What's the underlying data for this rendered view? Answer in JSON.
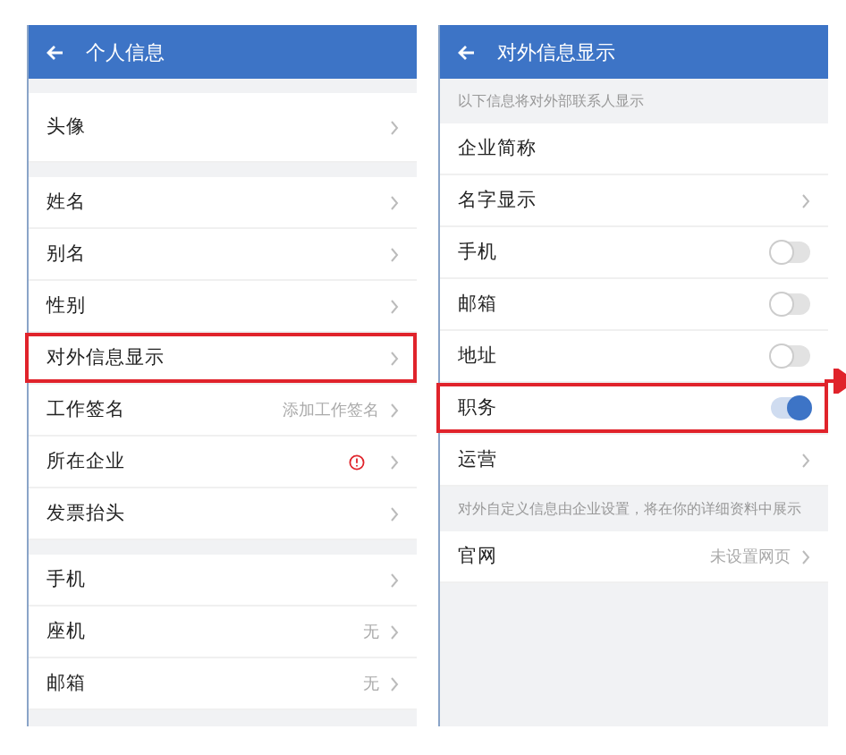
{
  "panels": [
    {
      "title": "个人信息",
      "groups": [
        {
          "rows": [
            {
              "kind": "link",
              "label": "头像",
              "tall": true,
              "highlighted": false
            }
          ]
        },
        {
          "rows": [
            {
              "kind": "link",
              "label": "姓名",
              "highlighted": false
            },
            {
              "kind": "link",
              "label": "别名",
              "highlighted": false
            },
            {
              "kind": "link",
              "label": "性别",
              "highlighted": false
            },
            {
              "kind": "link",
              "label": "对外信息显示",
              "highlighted": true
            },
            {
              "kind": "link",
              "label": "工作签名",
              "value": "添加工作签名",
              "highlighted": false
            },
            {
              "kind": "link",
              "label": "所在企业",
              "alert": true,
              "highlighted": false
            },
            {
              "kind": "link",
              "label": "发票抬头",
              "highlighted": false
            }
          ]
        },
        {
          "rows": [
            {
              "kind": "link",
              "label": "手机",
              "highlighted": false
            },
            {
              "kind": "link",
              "label": "座机",
              "value": "无",
              "highlighted": false
            },
            {
              "kind": "link",
              "label": "邮箱",
              "value": "无",
              "highlighted": false
            }
          ]
        }
      ]
    },
    {
      "title": "对外信息显示",
      "groups": [
        {
          "hint": "以下信息将对外部联系人显示",
          "rows": [
            {
              "kind": "plain",
              "label": "企业简称",
              "highlighted": false
            },
            {
              "kind": "link",
              "label": "名字显示",
              "highlighted": false
            },
            {
              "kind": "toggle",
              "label": "手机",
              "on": false,
              "highlighted": false
            },
            {
              "kind": "toggle",
              "label": "邮箱",
              "on": false,
              "highlighted": false
            },
            {
              "kind": "toggle",
              "label": "地址",
              "on": false,
              "highlighted": false
            },
            {
              "kind": "toggle",
              "label": "职务",
              "on": true,
              "highlighted": true,
              "arrow": true
            },
            {
              "kind": "link",
              "label": "运营",
              "highlighted": false
            }
          ]
        },
        {
          "hint": "对外自定义信息由企业设置，将在你的详细资料中展示",
          "rows": [
            {
              "kind": "link",
              "label": "官网",
              "value": "未设置网页",
              "highlighted": false
            }
          ]
        }
      ]
    }
  ]
}
